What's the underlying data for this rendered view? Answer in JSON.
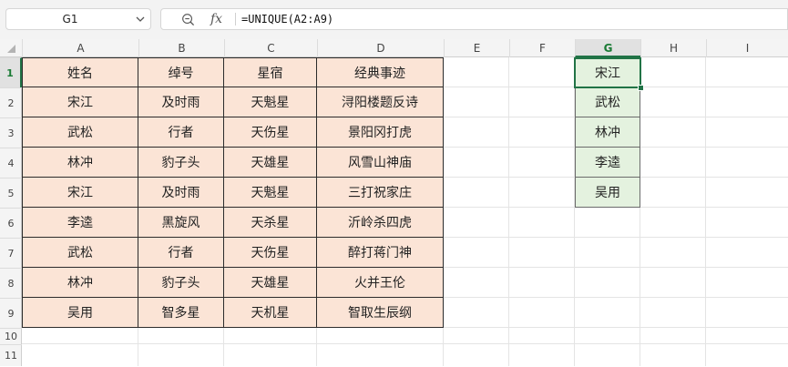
{
  "namebox": {
    "value": "G1",
    "chevron_icon": "chevron-down-icon"
  },
  "formula_bar": {
    "zoom_icon": "zoom-icon",
    "fx_label": "fx",
    "formula": "=UNIQUE(A2:A9)"
  },
  "columns": [
    "A",
    "B",
    "C",
    "D",
    "E",
    "F",
    "G",
    "H",
    "I"
  ],
  "rows": [
    "1",
    "2",
    "3",
    "4",
    "5",
    "6",
    "7",
    "8",
    "9",
    "10",
    "11"
  ],
  "selected": {
    "column": "G",
    "row": "1"
  },
  "table": {
    "header": [
      "姓名",
      "绰号",
      "星宿",
      "经典事迹"
    ],
    "rows": [
      [
        "宋江",
        "及时雨",
        "天魁星",
        "浔阳楼题反诗"
      ],
      [
        "武松",
        "行者",
        "天伤星",
        "景阳冈打虎"
      ],
      [
        "林冲",
        "豹子头",
        "天雄星",
        "风雪山神庙"
      ],
      [
        "宋江",
        "及时雨",
        "天魁星",
        "三打祝家庄"
      ],
      [
        "李逵",
        "黑旋风",
        "天杀星",
        "沂岭杀四虎"
      ],
      [
        "武松",
        "行者",
        "天伤星",
        "醉打蒋门神"
      ],
      [
        "林冲",
        "豹子头",
        "天雄星",
        "火并王伦"
      ],
      [
        "吴用",
        "智多星",
        "天机星",
        "智取生辰纲"
      ]
    ]
  },
  "unique_result": [
    "宋江",
    "武松",
    "林冲",
    "李逵",
    "吴用"
  ],
  "colors": {
    "table_fill": "#fbe4d6",
    "result_fill": "#e4f2df",
    "accent": "#217346"
  }
}
